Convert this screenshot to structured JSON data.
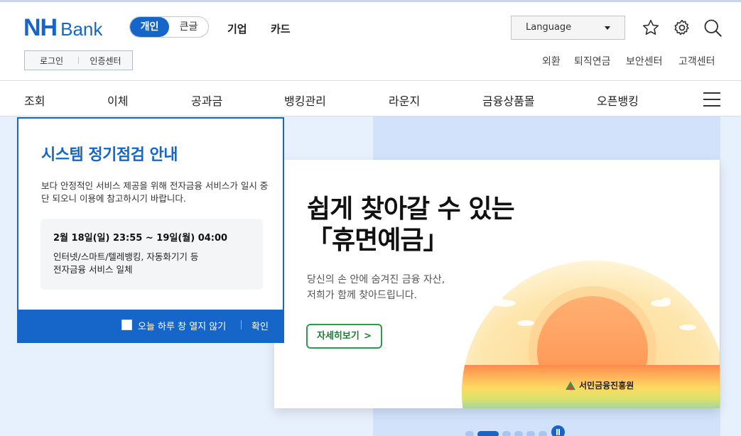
{
  "brand": {
    "nh": "NH",
    "bank": "Bank",
    "color": "#1566c8"
  },
  "segment": {
    "personal": "개인",
    "large": "큰글"
  },
  "top_menu": [
    "기업",
    "카드"
  ],
  "language": {
    "label": "Language"
  },
  "header_icons": [
    "star-icon",
    "gear-icon",
    "search-icon"
  ],
  "util": {
    "login": "로그인",
    "cert": "인증센터"
  },
  "quick_links": [
    "외환",
    "퇴직연금",
    "보안센터",
    "고객센터"
  ],
  "gnb": [
    "조회",
    "이체",
    "공과금",
    "뱅킹관리",
    "라운지",
    "금융상품몰",
    "오픈뱅킹"
  ],
  "banner": {
    "title_line1": "쉽게 찾아갈 수 있는",
    "title_line2": "「휴면예금」",
    "desc_line1": "당신의 손 안에 숨겨진 금융 자산,",
    "desc_line2": "저희가 함께 찾아드립니다.",
    "button": "자세히보기",
    "button_chevron": ">",
    "sponsor": "서민금융진흥원",
    "accent": "#2e9a4d"
  },
  "popup": {
    "title": "시스템 정기점검 안내",
    "desc": "보다 안정적인 서비스 제공을 위해 전자금융 서비스가 일시 중단 되오니 이용에 참고하시기 바랍니다.",
    "time": "2월 18일(일) 23:55 ~ 19일(월) 04:00",
    "services_line1": "인터넷/스마트/텔레뱅킹, 자동화기기 등",
    "services_line2": "전자금융 서비스 일체",
    "no_show_today": "오늘 하루 창 열지 않기",
    "confirm": "확인"
  },
  "pager": {
    "count": 6,
    "current": 1
  }
}
